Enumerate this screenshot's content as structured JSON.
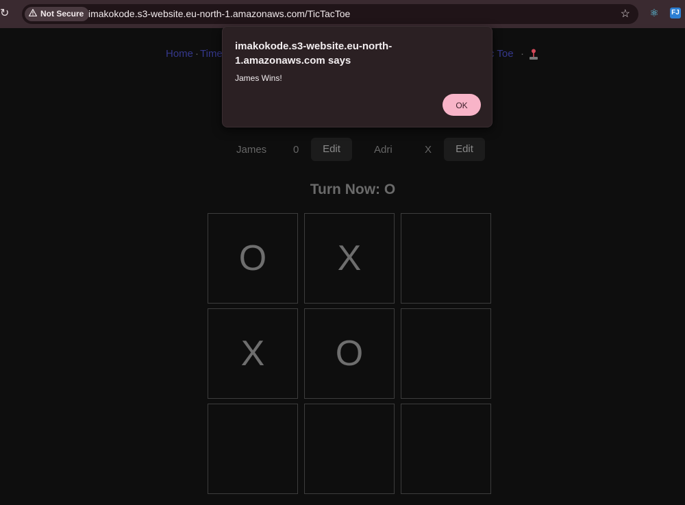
{
  "browser": {
    "security_label": "Not Secure",
    "url": "imakokode.s3-website.eu-north-1.amazonaws.com/TicTacToe",
    "ext2_label": "FJ"
  },
  "nav": {
    "items": [
      "Home",
      "Time",
      "c Toe"
    ],
    "separator": "·"
  },
  "players": [
    {
      "name": "James",
      "symbol": "0",
      "edit_label": "Edit"
    },
    {
      "name": "Adri",
      "symbol": "X",
      "edit_label": "Edit"
    }
  ],
  "turn_text": "Turn Now: O",
  "board": {
    "cells": [
      "O",
      "X",
      "",
      "X",
      "O",
      "",
      "",
      "",
      ""
    ]
  },
  "dialog": {
    "title": "imakokode.s3-website.eu-north-1.amazonaws.com says",
    "message": "James Wins!",
    "ok_label": "OK"
  },
  "colors": {
    "page_bg": "#0e0e0e",
    "toolbar_bg": "#3a2a30",
    "dialog_bg": "#2b2023",
    "ok_button": "#f8b4c8",
    "nav_link": "#35388c"
  }
}
